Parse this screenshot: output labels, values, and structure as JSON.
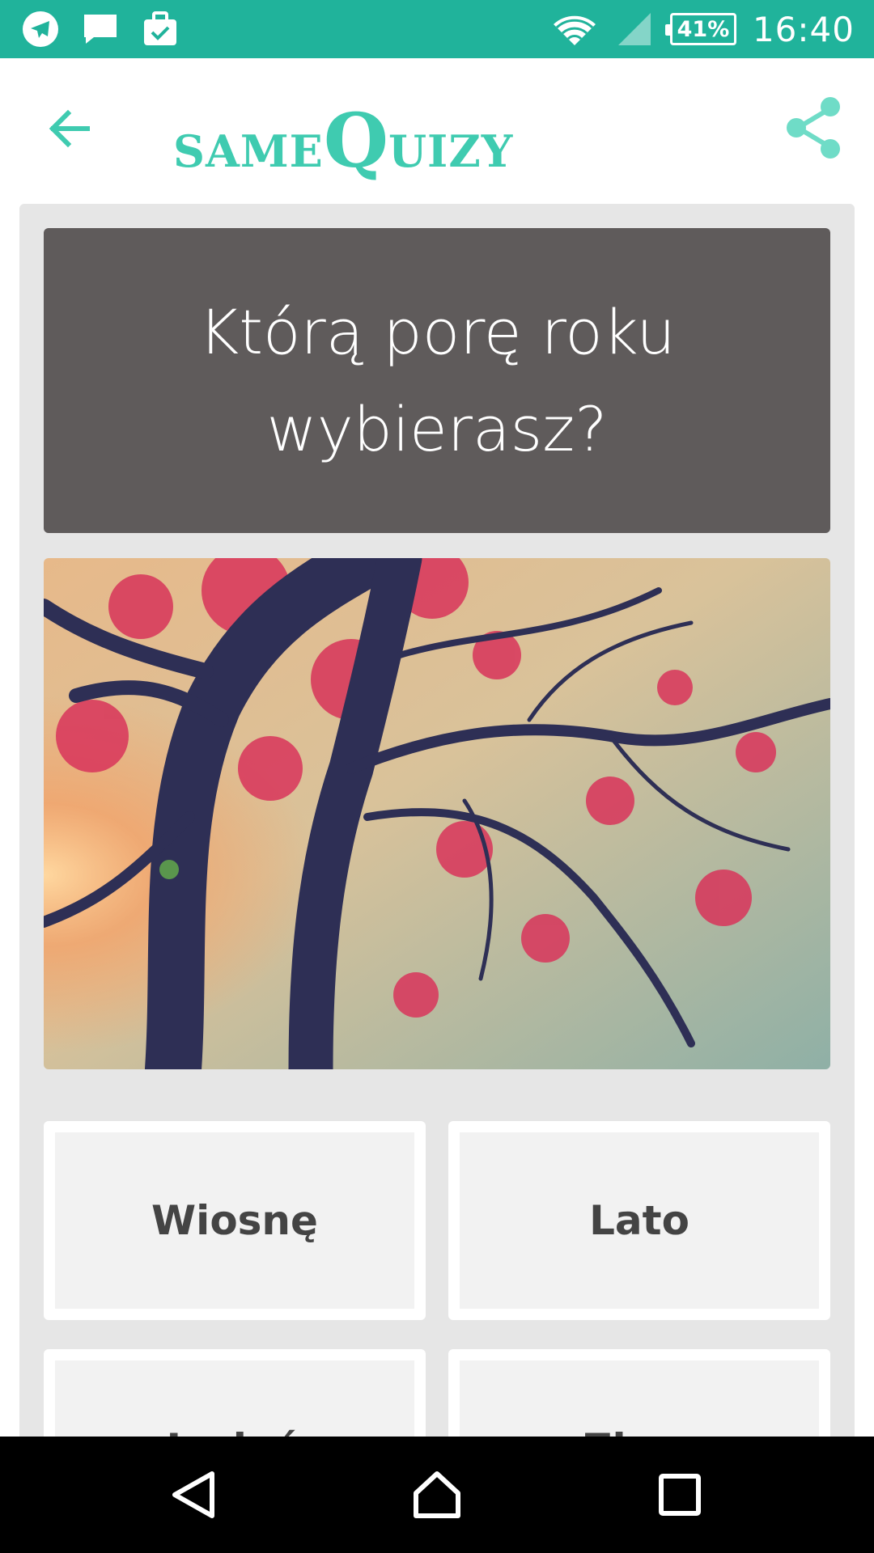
{
  "status_bar": {
    "left_icons": [
      "telegram-icon",
      "message-icon",
      "briefcase-check-icon"
    ],
    "battery": "41%",
    "time": "16:40",
    "bg_color": "#20b39b"
  },
  "app_bar": {
    "logo_part1": "SAME",
    "logo_part2": "Q",
    "logo_part3": "UIZY",
    "accent_color": "#3fcbb0"
  },
  "question": {
    "text": "Którą porę roku wybierasz?"
  },
  "answers": [
    {
      "label": "Wiosnę"
    },
    {
      "label": "Lato"
    },
    {
      "label": "Jesień"
    },
    {
      "label": "Zimę"
    }
  ]
}
